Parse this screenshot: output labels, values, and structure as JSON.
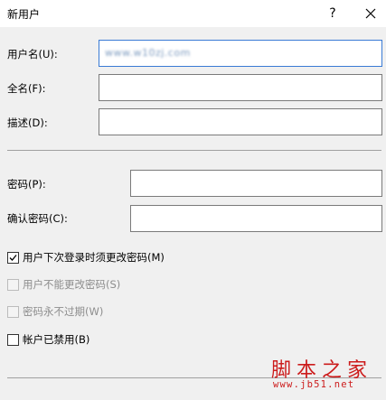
{
  "window": {
    "title": "新用户",
    "help_label": "?",
    "close_icon": "close-icon"
  },
  "form": {
    "username": {
      "label": "用户名(U):",
      "value": "www.w10zj.com"
    },
    "fullname": {
      "label": "全名(F):",
      "value": ""
    },
    "description": {
      "label": "描述(D):",
      "value": ""
    },
    "password": {
      "label": "密码(P):",
      "value": ""
    },
    "confirm_password": {
      "label": "确认密码(C):",
      "value": ""
    }
  },
  "options": [
    {
      "label": "用户下次登录时须更改密码(M)",
      "checked": true,
      "disabled": false
    },
    {
      "label": "用户不能更改密码(S)",
      "checked": false,
      "disabled": true
    },
    {
      "label": "密码永不过期(W)",
      "checked": false,
      "disabled": true
    },
    {
      "label": "帐户已禁用(B)",
      "checked": false,
      "disabled": false
    }
  ],
  "watermark": {
    "text": "脚本之家",
    "url": "www.jb51.net",
    "color": "#cc1c1c"
  },
  "colors": {
    "focus_border": "#3a7bd5",
    "background": "#f0f0f0"
  }
}
